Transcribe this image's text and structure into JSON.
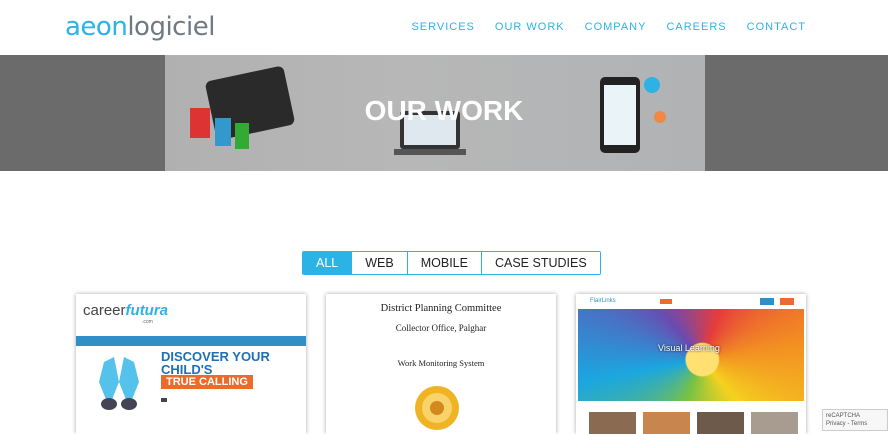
{
  "brand": {
    "part1": "aeon",
    "part2": "logiciel"
  },
  "nav": {
    "items": [
      "SERVICES",
      "OUR WORK",
      "COMPANY",
      "CAREERS",
      "CONTACT"
    ]
  },
  "hero": {
    "title": "OUR WORK"
  },
  "filters": {
    "tabs": [
      "ALL",
      "WEB",
      "MOBILE",
      "CASE STUDIES"
    ],
    "active": "ALL"
  },
  "cards": [
    {
      "logo_a": "career",
      "logo_b": "futura",
      "logo_tail": ".com",
      "headline_1": "DISCOVER YOUR",
      "headline_2": "CHILD'S",
      "badge": "TRUE CALLING"
    },
    {
      "title": "District Planning Committee",
      "subtitle": "Collector Office, Palghar",
      "system": "Work Monitoring System"
    },
    {
      "brand": "FlairLinks",
      "hero_label": "Visual Learning"
    }
  ],
  "recaptcha": {
    "line1": "reCAPTCHA",
    "line2": "Privacy - Terms"
  },
  "colors": {
    "accent": "#2bb3e6",
    "hero_bg": "#6b6b6b",
    "badge": "#ea6b2a"
  }
}
